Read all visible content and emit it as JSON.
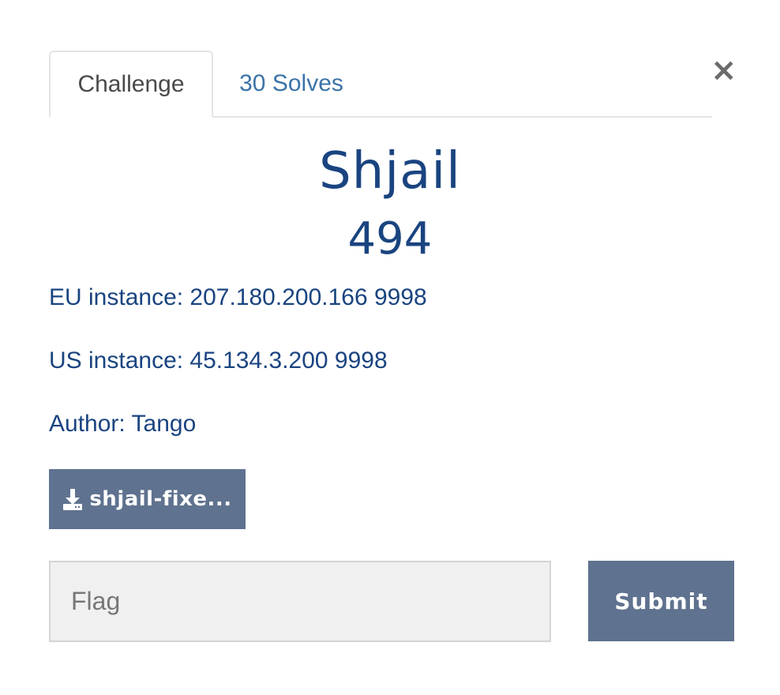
{
  "tabs": {
    "challenge": "Challenge",
    "solves": "30 Solves"
  },
  "close_icon": "×",
  "challenge": {
    "name": "Shjail",
    "value": "494",
    "eu_instance": "EU instance: 207.180.200.166 9998",
    "us_instance": "US instance: 45.134.3.200 9998",
    "author": "Author: Tango"
  },
  "file": {
    "icon": "download-icon",
    "name": "shjail-fixe..."
  },
  "flag": {
    "placeholder": "Flag",
    "value": ""
  },
  "submit_label": "Submit",
  "colors": {
    "primary_text": "#1a4480",
    "link": "#3b73a8",
    "button_bg": "#5f728f",
    "input_bg": "#f0f0f0"
  }
}
